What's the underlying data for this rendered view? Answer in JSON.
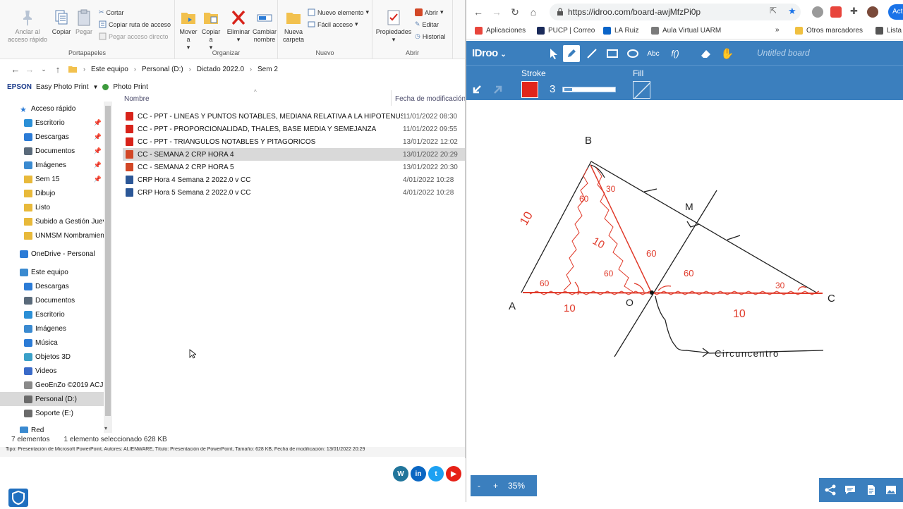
{
  "explorer": {
    "ribbon": {
      "portapapeles": {
        "label": "Portapapeles",
        "pin": "Anclar al acceso rápido",
        "copy": "Copiar",
        "paste": "Pegar",
        "cut": "Cortar",
        "copy_path": "Copiar ruta de acceso",
        "paste_shortcut": "Pegar acceso directo"
      },
      "organizar": {
        "label": "Organizar",
        "move": "Mover a",
        "copy_to": "Copiar a",
        "delete": "Eliminar",
        "rename": "Cambiar nombre"
      },
      "nuevo": {
        "label": "Nuevo",
        "new_folder": "Nueva carpeta",
        "new_item": "Nuevo elemento",
        "easy_access": "Fácil acceso"
      },
      "abrir": {
        "label": "Abrir",
        "properties": "Propiedades",
        "open": "Abrir",
        "edit": "Editar",
        "history": "Historial"
      }
    },
    "address": {
      "crumbs": [
        "Este equipo",
        "Personal (D:)",
        "Dictado 2022.0",
        "Sem 2"
      ]
    },
    "favbar": {
      "epson": "EPSON",
      "easy_photo": "Easy Photo Print",
      "photo_print": "Photo Print"
    },
    "nav": [
      {
        "label": "Acceso rápido",
        "indent": 0,
        "icon": "star-icon",
        "color": "#2b7bd6",
        "pinned": false
      },
      {
        "label": "Escritorio",
        "indent": 1,
        "icon": "desktop-icon",
        "color": "#2b8fd6",
        "pinned": true
      },
      {
        "label": "Descargas",
        "indent": 1,
        "icon": "download-icon",
        "color": "#2b7bd6",
        "pinned": true
      },
      {
        "label": "Documentos",
        "indent": 1,
        "icon": "document-icon",
        "color": "#5a6a7a",
        "pinned": true
      },
      {
        "label": "Imágenes",
        "indent": 1,
        "icon": "pictures-icon",
        "color": "#3a8ad0",
        "pinned": true
      },
      {
        "label": "Sem 15",
        "indent": 1,
        "icon": "folder-icon",
        "color": "#e8b93a",
        "pinned": true
      },
      {
        "label": "Dibujo",
        "indent": 1,
        "icon": "folder-icon",
        "color": "#e8b93a",
        "pinned": false
      },
      {
        "label": "Listo",
        "indent": 1,
        "icon": "folder-icon",
        "color": "#e8b93a",
        "pinned": false
      },
      {
        "label": "Subido a Gestión Juev",
        "indent": 1,
        "icon": "folder-icon",
        "color": "#e8b93a",
        "pinned": false
      },
      {
        "label": "UNMSM Nombramien",
        "indent": 1,
        "icon": "folder-icon",
        "color": "#e8b93a",
        "pinned": false
      },
      {
        "label": "OneDrive - Personal",
        "indent": 0,
        "icon": "cloud-icon",
        "color": "#2b7bd6",
        "pinned": false
      },
      {
        "label": "Este equipo",
        "indent": 0,
        "icon": "computer-icon",
        "color": "#3a8ad0",
        "pinned": false
      },
      {
        "label": "Descargas",
        "indent": 1,
        "icon": "download-icon",
        "color": "#2b7bd6",
        "pinned": false
      },
      {
        "label": "Documentos",
        "indent": 1,
        "icon": "document-icon",
        "color": "#5a6a7a",
        "pinned": false
      },
      {
        "label": "Escritorio",
        "indent": 1,
        "icon": "desktop-icon",
        "color": "#2b8fd6",
        "pinned": false
      },
      {
        "label": "Imágenes",
        "indent": 1,
        "icon": "pictures-icon",
        "color": "#3a8ad0",
        "pinned": false
      },
      {
        "label": "Música",
        "indent": 1,
        "icon": "music-icon",
        "color": "#2b7bd6",
        "pinned": false
      },
      {
        "label": "Objetos 3D",
        "indent": 1,
        "icon": "cube-icon",
        "color": "#3aa0c8",
        "pinned": false
      },
      {
        "label": "Videos",
        "indent": 1,
        "icon": "video-icon",
        "color": "#3a6ac8",
        "pinned": false
      },
      {
        "label": "GeoEnZo ©2019 ACJ (",
        "indent": 1,
        "icon": "drive-icon",
        "color": "#8a8a8a",
        "pinned": false
      },
      {
        "label": "Personal (D:)",
        "indent": 1,
        "icon": "drive-icon",
        "color": "#6a6a6a",
        "pinned": false,
        "selected": true
      },
      {
        "label": "Soporte (E:)",
        "indent": 1,
        "icon": "drive-icon",
        "color": "#6a6a6a",
        "pinned": false
      },
      {
        "label": "Red",
        "indent": 0,
        "icon": "network-icon",
        "color": "#3a8ad0",
        "pinned": false
      }
    ],
    "list": {
      "col_name": "Nombre",
      "col_date": "Fecha de modificación",
      "files": [
        {
          "name": "CC - PPT - LÍNEAS Y PUNTOS NOTABLES, MEDIANA RELATIVA A LA HIPOTENUSA",
          "date": "11/01/2022 08:30",
          "type": "pdf"
        },
        {
          "name": "CC - PPT - PROPORCIONALIDAD, THALES, BASE MEDIA Y SEMEJANZA",
          "date": "11/01/2022 09:55",
          "type": "pdf"
        },
        {
          "name": "CC - PPT - TRIÁNGULOS NOTABLES Y PITAGÓRICOS",
          "date": "13/01/2022 12:02",
          "type": "pdf"
        },
        {
          "name": "CC - SEMANA 2 CRP HORA 4",
          "date": "13/01/2022 20:29",
          "type": "pptx",
          "selected": true
        },
        {
          "name": "CC - SEMANA 2 CRP HORA 5",
          "date": "13/01/2022 20:30",
          "type": "pptx"
        },
        {
          "name": "CRP Hora 4 Semana 2 2022.0 v CC",
          "date": "4/01/2022 10:28",
          "type": "doc"
        },
        {
          "name": "CRP Hora 5 Semana 2 2022.0 v CC",
          "date": "4/01/2022 10:28",
          "type": "doc"
        }
      ]
    },
    "status": {
      "count": "7 elementos",
      "selected": "1 elemento seleccionado  628 KB"
    },
    "info": "Tipo: Presentación de Microsoft PowerPoint, Autores: ALIENWARE, Título: Presentación de PowerPoint, Tamaño: 628 KB, Fecha de modificación: 13/01/2022 20:29"
  },
  "social": [
    {
      "icon": "wordpress-icon",
      "color": "#21759b",
      "text": "W"
    },
    {
      "icon": "linkedin-icon",
      "color": "#0a66c2",
      "text": "in"
    },
    {
      "icon": "twitter-icon",
      "color": "#1da1f2",
      "text": "t"
    },
    {
      "icon": "youtube-icon",
      "color": "#e62117",
      "text": "▶"
    }
  ],
  "browser": {
    "url": "https://idroo.com/board-awjMfzPi0p",
    "action_label": "Act",
    "bookmarks": [
      {
        "label": "Aplicaciones",
        "icon": "apps-icon",
        "color": "#e8453c"
      },
      {
        "label": "PUCP | Correo",
        "icon": "pucp-icon",
        "color": "#1a2a5a"
      },
      {
        "label": "LA Ruiz",
        "icon": "outlook-icon",
        "color": "#0a64c8"
      },
      {
        "label": "Aula Virtual UARM",
        "icon": "uarm-icon",
        "color": "#7a7a7a"
      },
      {
        "label": "Otros marcadores",
        "icon": "folder-icon",
        "color": "#f0c040"
      },
      {
        "label": "Lista",
        "icon": "reading-list-icon",
        "color": "#555555"
      }
    ],
    "more": "»"
  },
  "idroo": {
    "logo": "IDroo",
    "board_title": "Untitled board",
    "stroke_label": "Stroke",
    "stroke_width": "3",
    "stroke_color": "#e1251b",
    "stroke_slider_fraction": 0.15,
    "fill_label": "Fill",
    "text_tool": "Abc",
    "func_tool": "f()",
    "zoom": {
      "minus": "-",
      "plus": "+",
      "value": "35%"
    },
    "drawing": {
      "labels": [
        "B",
        "M",
        "A",
        "O",
        "C",
        "10",
        "10",
        "10",
        "10",
        "60",
        "60",
        "60",
        "60",
        "60",
        "30",
        "30",
        "Circuncentro"
      ]
    }
  }
}
